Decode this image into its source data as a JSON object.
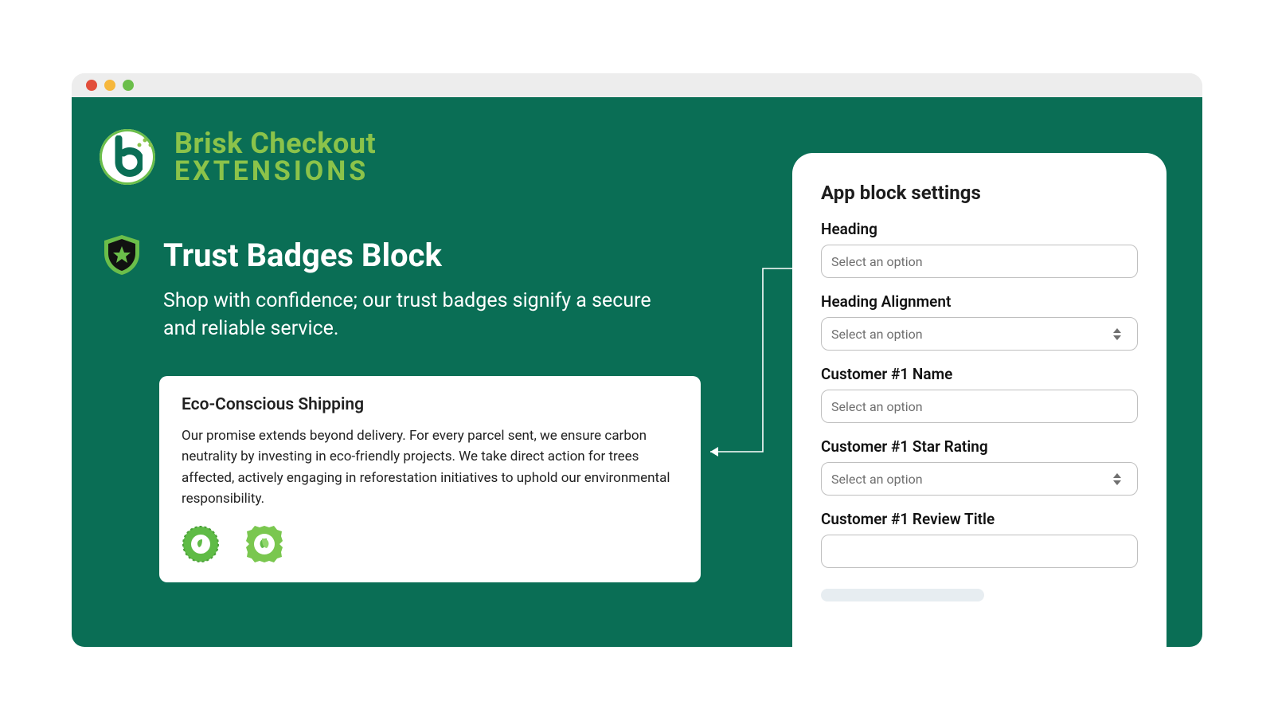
{
  "brand": {
    "line1": "Brisk Checkout",
    "line2": "EXTENSIONS"
  },
  "section": {
    "title": "Trust Badges Block",
    "subtitle": "Shop with confidence; our trust badges signify a secure and reliable service."
  },
  "preview": {
    "heading": "Eco-Conscious Shipping",
    "body": "Our promise extends beyond delivery. For every parcel sent, we ensure carbon neutrality by investing in eco-friendly projects. We take direct action for trees affected, actively engaging in reforestation initiatives to uphold our environmental responsibility.",
    "badges": [
      "carbon-neutral-seal",
      "eco-friendly-seal"
    ]
  },
  "panel": {
    "title": "App block settings",
    "fields": [
      {
        "label": "Heading",
        "placeholder": "Select an option",
        "type": "text"
      },
      {
        "label": "Heading Alignment",
        "placeholder": "Select an option",
        "type": "select"
      },
      {
        "label": "Customer #1 Name",
        "placeholder": "Select an option",
        "type": "text"
      },
      {
        "label": "Customer #1 Star Rating",
        "placeholder": "Select an option",
        "type": "select"
      },
      {
        "label": "Customer #1 Review Title",
        "placeholder": "",
        "type": "text"
      }
    ]
  },
  "colors": {
    "primary": "#0A6E55",
    "accent": "#8BC34A"
  }
}
